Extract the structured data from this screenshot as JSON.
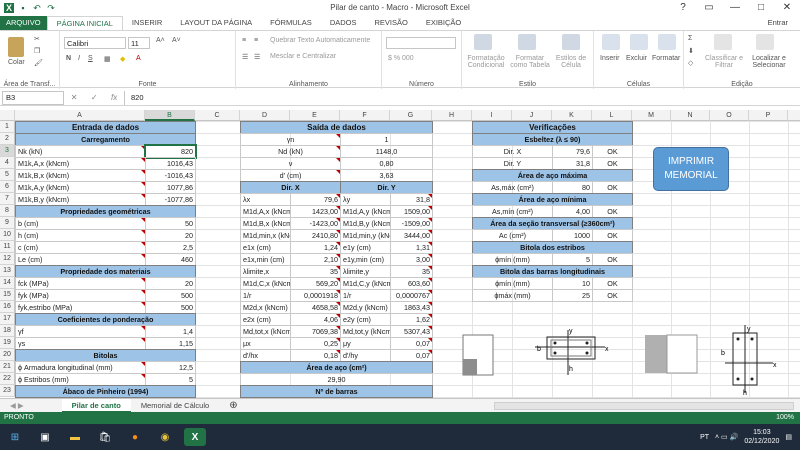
{
  "window": {
    "title": "Pilar de canto - Macro - Microsoft Excel",
    "user": "Entrar",
    "controls": [
      "?",
      "▭",
      "—",
      "□",
      "✕"
    ]
  },
  "ribbon_tabs": [
    "ARQUIVO",
    "PÁGINA INICIAL",
    "INSERIR",
    "LAYOUT DA PÁGINA",
    "FÓRMULAS",
    "DADOS",
    "REVISÃO",
    "EXIBIÇÃO"
  ],
  "ribbon": {
    "clipboard": {
      "paste": "Colar",
      "label": "Área de Transf..."
    },
    "font": {
      "name": "Calibri",
      "size": "11",
      "label": "Fonte"
    },
    "alignment": {
      "wrap": "Quebrar Texto Automaticamente",
      "merge": "Mesclar e Centralizar",
      "label": "Alinhamento"
    },
    "number": {
      "label": "Número"
    },
    "styles": {
      "cond": "Formatação Condicional",
      "table": "Formatar como Tabela",
      "cell": "Estilos de Célula",
      "label": "Estilo"
    },
    "cells": {
      "insert": "Inserir",
      "delete": "Excluir",
      "format": "Formatar",
      "label": "Células"
    },
    "editing": {
      "sort": "Classificar e Filtrar",
      "find": "Localizar e Selecionar",
      "label": "Edição"
    }
  },
  "formula_bar": {
    "name_box": "B3",
    "fx": "fx",
    "value": "820"
  },
  "columns": [
    "A",
    "B",
    "C",
    "D",
    "E",
    "F",
    "G",
    "H",
    "I",
    "J",
    "K",
    "L",
    "M",
    "N",
    "O",
    "P",
    "Q"
  ],
  "rows": [
    "1",
    "2",
    "3",
    "4",
    "5",
    "6",
    "7",
    "8",
    "9",
    "10",
    "11",
    "12",
    "13",
    "14",
    "15",
    "16",
    "17",
    "18",
    "19",
    "20",
    "21",
    "22",
    "23"
  ],
  "entrada": {
    "title": "Entrada de dados",
    "carregamento": "Carregamento",
    "items": [
      {
        "label": "Nk (kN)",
        "value": "820"
      },
      {
        "label": "M1k,A,x (kNcm)",
        "value": "1016,43"
      },
      {
        "label": "M1k,B,x (kNcm)",
        "value": "-1016,43"
      },
      {
        "label": "M1k,A,y (kNcm)",
        "value": "1077,86"
      },
      {
        "label": "M1k,B,y (kNcm)",
        "value": "-1077,86"
      }
    ],
    "geo_title": "Propriedades geométricas",
    "geo": [
      {
        "label": "b (cm)",
        "value": "50"
      },
      {
        "label": "h (cm)",
        "value": "20"
      },
      {
        "label": "c (cm)",
        "value": "2,5"
      },
      {
        "label": "Le (cm)",
        "value": "460"
      }
    ],
    "mat_title": "Propriedade dos materiais",
    "mat": [
      {
        "label": "fck (MPa)",
        "value": "20"
      },
      {
        "label": "fyk (MPa)",
        "value": "500"
      },
      {
        "label": "fyk,estribo (MPa)",
        "value": "500"
      }
    ],
    "coef_title": "Coeficientes de ponderação",
    "coef": [
      {
        "label": "γf",
        "value": "1,4"
      },
      {
        "label": "γs",
        "value": "1,15"
      }
    ],
    "bit_title": "Bitolas",
    "bit": [
      {
        "label": "ϕ Armadura longitudinal (mm)",
        "value": "12,5"
      },
      {
        "label": "ϕ Estribos (mm)",
        "value": "5"
      }
    ],
    "abaco": "Ábaco de Pinheiro (1994)"
  },
  "saida": {
    "title": "Saída de dados",
    "top": [
      {
        "label": "γn",
        "value": "1"
      },
      {
        "label": "Nd (kN)",
        "value": "1148,0"
      },
      {
        "label": "ν",
        "value": "0,80"
      },
      {
        "label": "d' (cm)",
        "value": "3,63"
      }
    ],
    "dirx": "Dir. X",
    "diry": "Dir. Y",
    "rows": [
      {
        "a": "λx",
        "b": "79,6",
        "c": "λy",
        "d": "31,8"
      },
      {
        "a": "M1d,A,x (kNcm)",
        "b": "1423,00",
        "c": "M1d,A,y (kNcm)",
        "d": "1509,00"
      },
      {
        "a": "M1d,B,x (kNcm)",
        "b": "-1423,00",
        "c": "M1d,B,y (kNcm)",
        "d": "-1509,00"
      },
      {
        "a": "M1d,min,x (kNcm)",
        "b": "2410,80",
        "c": "M1d,min,y (kNcm)",
        "d": "3444,00"
      },
      {
        "a": "e1x (cm)",
        "b": "1,24",
        "c": "e1y (cm)",
        "d": "1,31"
      },
      {
        "a": "e1x,min (cm)",
        "b": "2,10",
        "c": "e1y,min (cm)",
        "d": "3,00"
      },
      {
        "a": "λlimite,x",
        "b": "35",
        "c": "λlimite,y",
        "d": "35"
      },
      {
        "a": "M1d,C,x (kNcm)",
        "b": "569,20",
        "c": "M1d,C,y (kNcm)",
        "d": "603,60"
      },
      {
        "a": "1/r",
        "b": "0,0001918",
        "c": "1/r",
        "d": "0,0000767"
      },
      {
        "a": "M2d,x (kNcm)",
        "b": "4658,58",
        "c": "M2d,y (kNcm)",
        "d": "1863,43"
      },
      {
        "a": "e2x (cm)",
        "b": "4,06",
        "c": "e2y (cm)",
        "d": "1,62"
      },
      {
        "a": "Md,tot,x (kNcm)",
        "b": "7069,38",
        "c": "Md,tot,y (kNcm)",
        "d": "5307,43"
      },
      {
        "a": "μx",
        "b": "0,25",
        "c": "μy",
        "d": "0,07"
      },
      {
        "a": "d'/hx",
        "b": "0,18",
        "c": "d'/hy",
        "d": "0,07"
      }
    ],
    "area_title": "Área de aço (cm²)",
    "area_value": "29,90",
    "barras_title": "Nº de barras"
  },
  "verif": {
    "title": "Verificações",
    "esbeltez": "Esbeltez (λ ≤ 90)",
    "esb": [
      {
        "label": "Dir. X",
        "value": "79,6",
        "ok": "OK"
      },
      {
        "label": "Dir. Y",
        "value": "31,8",
        "ok": "OK"
      }
    ],
    "amax_title": "Área de aço máxima",
    "amax": {
      "label": "As,máx (cm²)",
      "value": "80",
      "ok": "OK"
    },
    "amin_title": "Área de aço mínima",
    "amin": {
      "label": "As,mín (cm²)",
      "value": "4,00",
      "ok": "OK"
    },
    "sec_title": "Área da seção transversal (≥360cm²)",
    "sec": {
      "label": "Ac (cm²)",
      "value": "1000",
      "ok": "OK"
    },
    "estr_title": "Bitola dos estribos",
    "estr": {
      "label": "ϕmín (mm)",
      "value": "5",
      "ok": "OK"
    },
    "long_title": "Bitola das barras longitudinais",
    "long": [
      {
        "label": "ϕmín (mm)",
        "value": "10",
        "ok": "OK"
      },
      {
        "label": "ϕmáx (mm)",
        "value": "25",
        "ok": "OK"
      }
    ]
  },
  "print_button": "IMPRIMIR MEMORIAL",
  "diagram_labels": {
    "x": "x",
    "y": "y",
    "b": "b",
    "h": "h"
  },
  "sheets": [
    "Pilar de canto",
    "Memorial de Cálculo"
  ],
  "status": {
    "text": "PRONTO",
    "zoom": "100%"
  },
  "taskbar": {
    "lang": "PT",
    "time": "15:03",
    "date": "02/12/2020"
  }
}
